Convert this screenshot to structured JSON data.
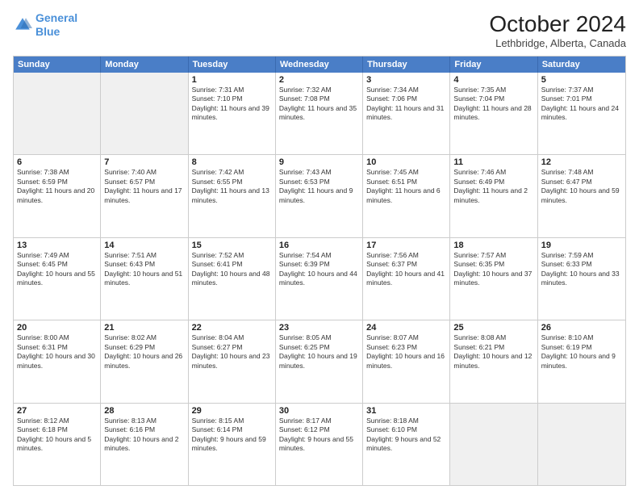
{
  "header": {
    "logo_line1": "General",
    "logo_line2": "Blue",
    "month": "October 2024",
    "location": "Lethbridge, Alberta, Canada"
  },
  "days_of_week": [
    "Sunday",
    "Monday",
    "Tuesday",
    "Wednesday",
    "Thursday",
    "Friday",
    "Saturday"
  ],
  "weeks": [
    [
      {
        "day": "",
        "sunrise": "",
        "sunset": "",
        "daylight": "",
        "shaded": true
      },
      {
        "day": "",
        "sunrise": "",
        "sunset": "",
        "daylight": "",
        "shaded": true
      },
      {
        "day": "1",
        "sunrise": "Sunrise: 7:31 AM",
        "sunset": "Sunset: 7:10 PM",
        "daylight": "Daylight: 11 hours and 39 minutes."
      },
      {
        "day": "2",
        "sunrise": "Sunrise: 7:32 AM",
        "sunset": "Sunset: 7:08 PM",
        "daylight": "Daylight: 11 hours and 35 minutes."
      },
      {
        "day": "3",
        "sunrise": "Sunrise: 7:34 AM",
        "sunset": "Sunset: 7:06 PM",
        "daylight": "Daylight: 11 hours and 31 minutes."
      },
      {
        "day": "4",
        "sunrise": "Sunrise: 7:35 AM",
        "sunset": "Sunset: 7:04 PM",
        "daylight": "Daylight: 11 hours and 28 minutes."
      },
      {
        "day": "5",
        "sunrise": "Sunrise: 7:37 AM",
        "sunset": "Sunset: 7:01 PM",
        "daylight": "Daylight: 11 hours and 24 minutes."
      }
    ],
    [
      {
        "day": "6",
        "sunrise": "Sunrise: 7:38 AM",
        "sunset": "Sunset: 6:59 PM",
        "daylight": "Daylight: 11 hours and 20 minutes."
      },
      {
        "day": "7",
        "sunrise": "Sunrise: 7:40 AM",
        "sunset": "Sunset: 6:57 PM",
        "daylight": "Daylight: 11 hours and 17 minutes."
      },
      {
        "day": "8",
        "sunrise": "Sunrise: 7:42 AM",
        "sunset": "Sunset: 6:55 PM",
        "daylight": "Daylight: 11 hours and 13 minutes."
      },
      {
        "day": "9",
        "sunrise": "Sunrise: 7:43 AM",
        "sunset": "Sunset: 6:53 PM",
        "daylight": "Daylight: 11 hours and 9 minutes."
      },
      {
        "day": "10",
        "sunrise": "Sunrise: 7:45 AM",
        "sunset": "Sunset: 6:51 PM",
        "daylight": "Daylight: 11 hours and 6 minutes."
      },
      {
        "day": "11",
        "sunrise": "Sunrise: 7:46 AM",
        "sunset": "Sunset: 6:49 PM",
        "daylight": "Daylight: 11 hours and 2 minutes."
      },
      {
        "day": "12",
        "sunrise": "Sunrise: 7:48 AM",
        "sunset": "Sunset: 6:47 PM",
        "daylight": "Daylight: 10 hours and 59 minutes."
      }
    ],
    [
      {
        "day": "13",
        "sunrise": "Sunrise: 7:49 AM",
        "sunset": "Sunset: 6:45 PM",
        "daylight": "Daylight: 10 hours and 55 minutes."
      },
      {
        "day": "14",
        "sunrise": "Sunrise: 7:51 AM",
        "sunset": "Sunset: 6:43 PM",
        "daylight": "Daylight: 10 hours and 51 minutes."
      },
      {
        "day": "15",
        "sunrise": "Sunrise: 7:52 AM",
        "sunset": "Sunset: 6:41 PM",
        "daylight": "Daylight: 10 hours and 48 minutes."
      },
      {
        "day": "16",
        "sunrise": "Sunrise: 7:54 AM",
        "sunset": "Sunset: 6:39 PM",
        "daylight": "Daylight: 10 hours and 44 minutes."
      },
      {
        "day": "17",
        "sunrise": "Sunrise: 7:56 AM",
        "sunset": "Sunset: 6:37 PM",
        "daylight": "Daylight: 10 hours and 41 minutes."
      },
      {
        "day": "18",
        "sunrise": "Sunrise: 7:57 AM",
        "sunset": "Sunset: 6:35 PM",
        "daylight": "Daylight: 10 hours and 37 minutes."
      },
      {
        "day": "19",
        "sunrise": "Sunrise: 7:59 AM",
        "sunset": "Sunset: 6:33 PM",
        "daylight": "Daylight: 10 hours and 33 minutes."
      }
    ],
    [
      {
        "day": "20",
        "sunrise": "Sunrise: 8:00 AM",
        "sunset": "Sunset: 6:31 PM",
        "daylight": "Daylight: 10 hours and 30 minutes."
      },
      {
        "day": "21",
        "sunrise": "Sunrise: 8:02 AM",
        "sunset": "Sunset: 6:29 PM",
        "daylight": "Daylight: 10 hours and 26 minutes."
      },
      {
        "day": "22",
        "sunrise": "Sunrise: 8:04 AM",
        "sunset": "Sunset: 6:27 PM",
        "daylight": "Daylight: 10 hours and 23 minutes."
      },
      {
        "day": "23",
        "sunrise": "Sunrise: 8:05 AM",
        "sunset": "Sunset: 6:25 PM",
        "daylight": "Daylight: 10 hours and 19 minutes."
      },
      {
        "day": "24",
        "sunrise": "Sunrise: 8:07 AM",
        "sunset": "Sunset: 6:23 PM",
        "daylight": "Daylight: 10 hours and 16 minutes."
      },
      {
        "day": "25",
        "sunrise": "Sunrise: 8:08 AM",
        "sunset": "Sunset: 6:21 PM",
        "daylight": "Daylight: 10 hours and 12 minutes."
      },
      {
        "day": "26",
        "sunrise": "Sunrise: 8:10 AM",
        "sunset": "Sunset: 6:19 PM",
        "daylight": "Daylight: 10 hours and 9 minutes."
      }
    ],
    [
      {
        "day": "27",
        "sunrise": "Sunrise: 8:12 AM",
        "sunset": "Sunset: 6:18 PM",
        "daylight": "Daylight: 10 hours and 5 minutes."
      },
      {
        "day": "28",
        "sunrise": "Sunrise: 8:13 AM",
        "sunset": "Sunset: 6:16 PM",
        "daylight": "Daylight: 10 hours and 2 minutes."
      },
      {
        "day": "29",
        "sunrise": "Sunrise: 8:15 AM",
        "sunset": "Sunset: 6:14 PM",
        "daylight": "Daylight: 9 hours and 59 minutes."
      },
      {
        "day": "30",
        "sunrise": "Sunrise: 8:17 AM",
        "sunset": "Sunset: 6:12 PM",
        "daylight": "Daylight: 9 hours and 55 minutes."
      },
      {
        "day": "31",
        "sunrise": "Sunrise: 8:18 AM",
        "sunset": "Sunset: 6:10 PM",
        "daylight": "Daylight: 9 hours and 52 minutes."
      },
      {
        "day": "",
        "sunrise": "",
        "sunset": "",
        "daylight": "",
        "shaded": true
      },
      {
        "day": "",
        "sunrise": "",
        "sunset": "",
        "daylight": "",
        "shaded": true
      }
    ]
  ]
}
